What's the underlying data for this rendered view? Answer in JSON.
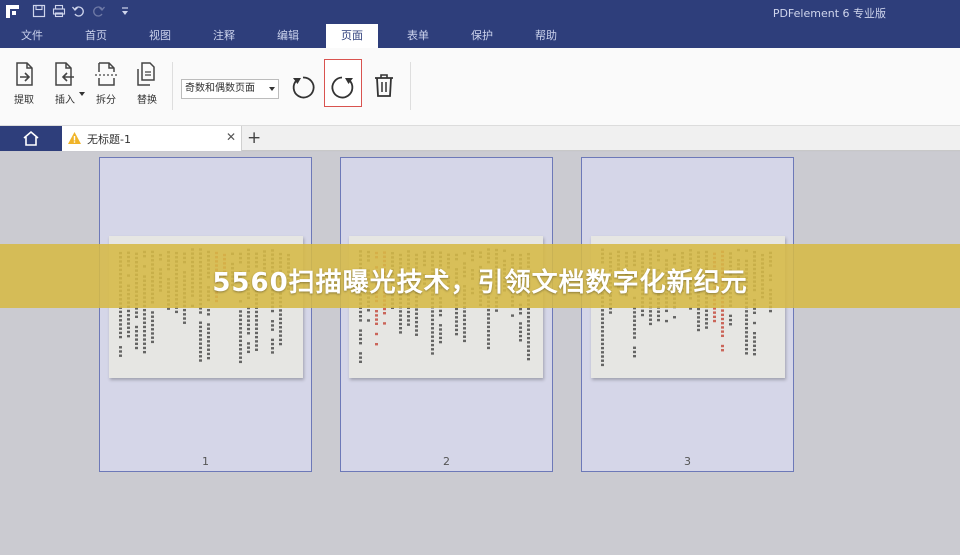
{
  "titlebar": {
    "app_title": "PDFelement  6 专业版",
    "quick_access": [
      "save-icon",
      "print-icon",
      "undo-icon",
      "redo-icon",
      "customize-icon"
    ]
  },
  "menu": {
    "items": [
      {
        "label": "文件",
        "active": false
      },
      {
        "label": "首页",
        "active": false
      },
      {
        "label": "视图",
        "active": false
      },
      {
        "label": "注释",
        "active": false
      },
      {
        "label": "编辑",
        "active": false
      },
      {
        "label": "页面",
        "active": true
      },
      {
        "label": "表单",
        "active": false
      },
      {
        "label": "保护",
        "active": false
      },
      {
        "label": "帮助",
        "active": false
      }
    ]
  },
  "toolbar": {
    "extract_label": "提取",
    "insert_label": "插入",
    "split_label": "拆分",
    "replace_label": "替换",
    "page_range_select": "奇数和偶数页面"
  },
  "tabs": {
    "document_name": "无标题-1"
  },
  "pages": [
    {
      "number": "1"
    },
    {
      "number": "2"
    },
    {
      "number": "3"
    }
  ],
  "banner": {
    "text": "5560扫描曝光技术，引领文档数字化新纪元"
  },
  "colors": {
    "titlebar_bg": "#2e3e7b",
    "selected_border": "#d9534f",
    "page_border": "#6d79b8",
    "banner_bg": "#d6ba46"
  }
}
